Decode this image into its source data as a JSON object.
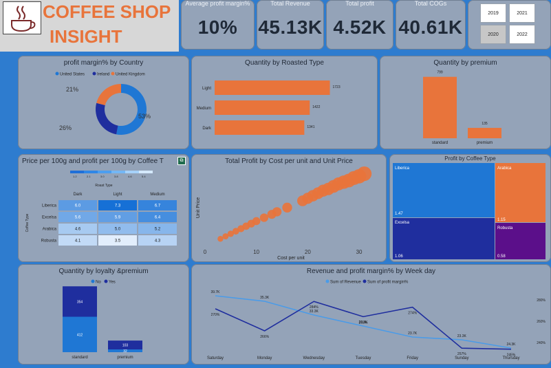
{
  "header": {
    "title_line1": "COFFEE SHOP",
    "title_line2": "INSIGHT",
    "logo_icon": "coffee-cup-icon",
    "title_color": "#e8743b"
  },
  "kpis": [
    {
      "label": "Average profit margin%",
      "value": "10%"
    },
    {
      "label": "Total Revenue",
      "value": "45.13K"
    },
    {
      "label": "Total profit",
      "value": "4.52K"
    },
    {
      "label": "Total COGs",
      "value": "40.61K"
    }
  ],
  "year_slicer": {
    "years": [
      "2019",
      "2021",
      "2020",
      "2022"
    ],
    "selected": "2020"
  },
  "colors": {
    "blue": "#1f77d4",
    "navy": "#1f2e9e",
    "orange": "#e8743b",
    "light_blue": "#4a9be8",
    "purple": "#5b0f8a",
    "blue2": "#1877d6"
  },
  "country_chart": {
    "title": "profit margin% by Country",
    "chart_data": {
      "type": "pie",
      "donut": true,
      "categories": [
        "United States",
        "Ireland",
        "United Kingdom"
      ],
      "values": [
        53,
        26,
        21
      ],
      "labels": [
        "53%",
        "26%",
        "21%"
      ],
      "legend_position": "top"
    }
  },
  "roast_chart": {
    "title": "Quantity by Roasted Type",
    "chart_data": {
      "type": "bar",
      "orientation": "horizontal",
      "categories": [
        "Light",
        "Medium",
        "Dark"
      ],
      "values": [
        1723,
        1422,
        1341
      ],
      "data_labels": [
        "1723",
        "1422",
        "1341"
      ],
      "xlim": [
        0,
        1800
      ]
    }
  },
  "premium_chart": {
    "title": "Quantity by premium",
    "chart_data": {
      "type": "bar",
      "categories": [
        "standard",
        "premium"
      ],
      "values": [
        799,
        135
      ],
      "data_labels": [
        "799",
        "135"
      ],
      "ylim": [
        0,
        850
      ]
    }
  },
  "heatmap_chart": {
    "title": "Price per 100g and profit per 100g by Coffee T",
    "legend_title": "Roast Type",
    "legend_ticks": [
      "1.2",
      "2.1",
      "3.0",
      "3.8",
      "4.6",
      "5.4"
    ],
    "ylabel": "Coffee Type",
    "chart_data": {
      "type": "heatmap",
      "columns": [
        "Dark",
        "Light",
        "Medium"
      ],
      "rows": [
        "Liberica",
        "Excelsa",
        "Arabica",
        "Robusta"
      ],
      "values": [
        [
          6.0,
          7.3,
          6.7
        ],
        [
          5.6,
          5.9,
          6.4
        ],
        [
          4.6,
          5.0,
          5.2
        ],
        [
          4.1,
          3.5,
          4.3
        ]
      ],
      "cell_labels": [
        [
          "6.0",
          "7.3",
          "6.7"
        ],
        [
          "5.6",
          "5.9",
          "6.4"
        ],
        [
          "4.6",
          "5.0",
          "5.2"
        ],
        [
          "4.1",
          "3.5",
          "4.3"
        ]
      ]
    }
  },
  "scatter_chart": {
    "title": "Total Profit by Cost per unit and Unit Price",
    "chart_data": {
      "type": "scatter",
      "xlabel": "Cost per unit",
      "ylabel": "Unit Price",
      "xlim": [
        0,
        32
      ],
      "ylim": [
        0,
        48
      ],
      "xticks": [
        "0",
        "10",
        "20",
        "30"
      ],
      "points": [
        [
          3,
          6
        ],
        [
          4,
          7.5
        ],
        [
          5,
          9
        ],
        [
          6,
          10.5
        ],
        [
          7,
          12
        ],
        [
          8,
          13.5
        ],
        [
          9,
          15
        ],
        [
          10,
          16.5
        ],
        [
          11.5,
          18.5
        ],
        [
          13,
          20.5
        ],
        [
          14,
          22
        ],
        [
          16,
          24.5
        ],
        [
          19,
          28.5
        ],
        [
          20,
          30
        ],
        [
          21,
          31.5
        ],
        [
          22,
          33
        ],
        [
          23,
          34.5
        ],
        [
          24,
          35.5
        ],
        [
          25,
          37
        ],
        [
          26,
          38.5
        ],
        [
          27,
          39.5
        ],
        [
          28,
          40.5
        ],
        [
          29,
          42
        ],
        [
          30,
          43
        ],
        [
          31,
          44.5
        ]
      ]
    }
  },
  "treemap_chart": {
    "title": "Profit by Coffee Type",
    "chart_data": {
      "type": "treemap",
      "categories": [
        "Liberica",
        "Arabica",
        "Excelsa",
        "Robusta"
      ],
      "values": [
        1.47,
        1.15,
        1.06,
        0.58
      ],
      "data_labels": [
        "1.47",
        "1.15",
        "1.06",
        "0.58"
      ]
    }
  },
  "loyalty_chart": {
    "title": "Quantity by loyalty &premium",
    "chart_data": {
      "type": "bar",
      "stacked": true,
      "categories": [
        "standard",
        "premium"
      ],
      "ylim": [
        0,
        500
      ],
      "series": [
        {
          "name": "No",
          "values": [
            412,
            32
          ],
          "data_labels": [
            "412",
            "32"
          ]
        },
        {
          "name": "Yes",
          "values": [
            354,
            103
          ],
          "data_labels": [
            "354",
            "103"
          ]
        }
      ]
    }
  },
  "weekday_chart": {
    "title": "Revenue and profit margin% by Week day",
    "chart_data": {
      "type": "line",
      "categories": [
        "Saturday",
        "Monday",
        "Wednesday",
        "Tuesday",
        "Friday",
        "Sunday",
        "Thursday"
      ],
      "series": [
        {
          "name": "Sum of Revenue",
          "values": [
            7.1,
            6.9,
            6.4,
            6.0,
            5.6,
            5.5,
            5.2
          ],
          "data_labels": [
            "39.7K",
            "35.3K",
            "33.3K",
            "27.3K",
            "23.7K",
            "23.3K",
            "24.3K"
          ]
        },
        {
          "name": "Sum of profit margin%",
          "values": [
            260,
            218,
            274,
            245,
            263,
            185,
            183
          ],
          "data_labels": [
            "270%",
            "266%",
            "284%",
            "268%",
            "274%",
            "257%",
            "245%"
          ]
        }
      ],
      "right_axis_ticks": [
        "280%",
        "260%",
        "240%"
      ]
    }
  }
}
